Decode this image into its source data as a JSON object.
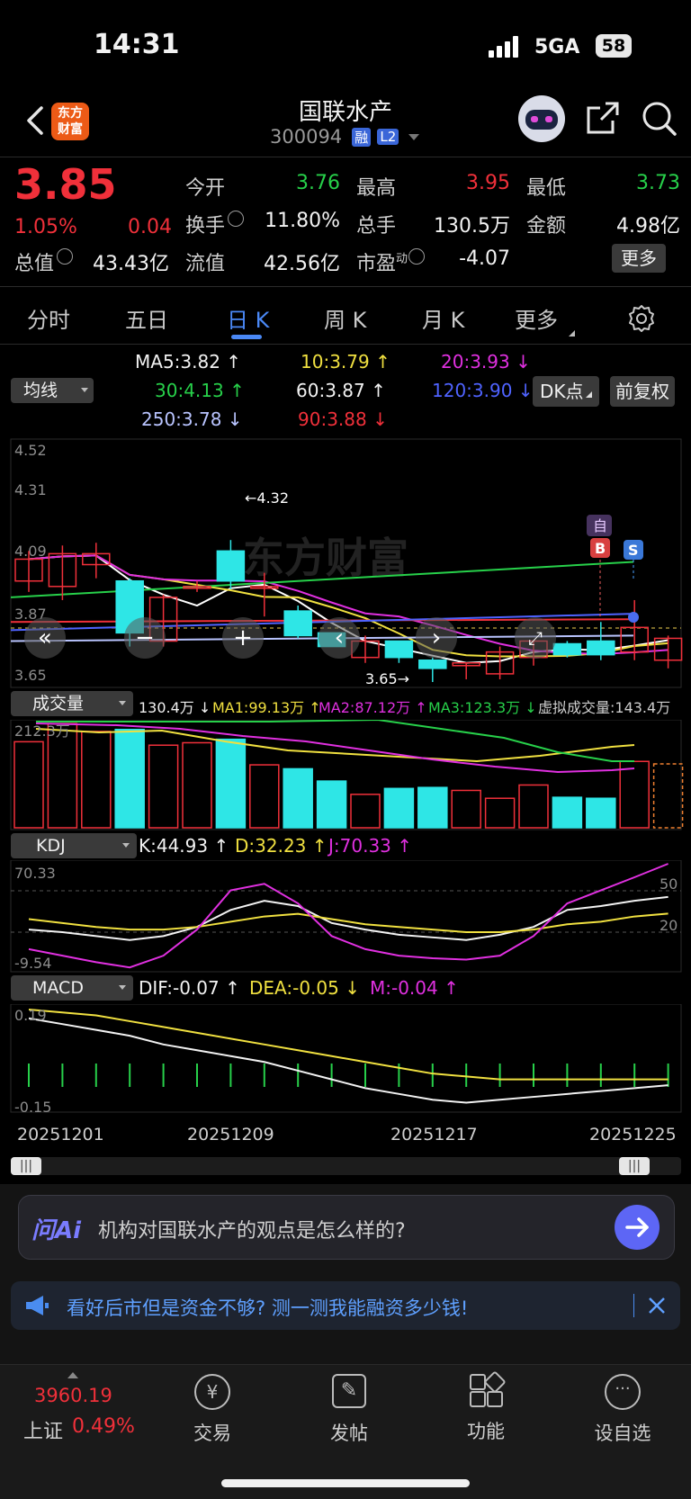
{
  "status_bar": {
    "time": "14:31",
    "network": "5GA",
    "battery": "58"
  },
  "header": {
    "logo_line1": "东方",
    "logo_line2": "财富",
    "stock_name": "国联水产",
    "stock_code": "300094",
    "badge_rong": "融",
    "badge_l2": "L2"
  },
  "quote": {
    "price": "3.85",
    "change_pct": "1.05%",
    "change": "0.04",
    "open_label": "今开",
    "open": "3.76",
    "high_label": "最高",
    "high": "3.95",
    "low_label": "最低",
    "low": "3.73",
    "turnover_label": "换手",
    "turnover": "11.80%",
    "volume_label": "总手",
    "volume": "130.5万",
    "amount_label": "金额",
    "amount": "4.98亿",
    "mktcap_label": "总值",
    "mktcap": "43.43亿",
    "float_label": "流值",
    "float_cap": "42.56亿",
    "pe_label": "市盈",
    "pe_sup": "动",
    "pe": "-4.07",
    "more_label": "更多"
  },
  "tabs": [
    "分时",
    "五日",
    "日 K",
    "周 K",
    "月 K",
    "更多"
  ],
  "ma_legend": {
    "selector": "均线",
    "ma5": "MA5:3.82 ↑",
    "ma10": "10:3.79 ↑",
    "ma20": "20:3.93 ↓",
    "ma30": "30:4.13 ↑",
    "ma60": "60:3.87 ↑",
    "ma120": "120:3.90 ↓",
    "ma250": "250:3.78 ↓",
    "ma90": "90:3.88 ↓",
    "dk_label": "DK点",
    "fq_label": "前复权"
  },
  "price_chart": {
    "y_labels": [
      "4.52",
      "4.31",
      "4.09",
      "3.87",
      "3.65"
    ],
    "high_annot": "←4.32",
    "low_annot": "3.65→",
    "watermark": "东方财富",
    "marker_zi": "自",
    "marker_b": "B",
    "marker_s": "S"
  },
  "volume_legend": {
    "selector": "成交量",
    "vol": "130.4万 ↓",
    "ma1": "MA1:99.13万 ↑",
    "ma2": "MA2:87.12万 ↑",
    "ma3": "MA3:123.3万 ↓",
    "virtual": "虚拟成交量:143.4万",
    "y_max": "212.3万"
  },
  "kdj_legend": {
    "selector": "KDJ",
    "k": "K:44.93 ↑",
    "d": "D:32.23 ↑",
    "j": "J:70.33 ↑",
    "y_top": "70.33",
    "y_bottom": "-9.54",
    "ref50": "50",
    "ref20": "20"
  },
  "macd_legend": {
    "selector": "MACD",
    "dif": "DIF:-0.07 ↑",
    "dea": "DEA:-0.05 ↓",
    "m": "M:-0.04 ↑",
    "y_top": "0.19",
    "y_bottom": "-0.15"
  },
  "dates": [
    "20251201",
    "20251209",
    "20251217",
    "20251225"
  ],
  "ai_bar": {
    "logo": "问Ai",
    "prompt": "机构对国联水产的观点是怎么样的?"
  },
  "ad_banner": {
    "text": "看好后市但是资金不够? 测一测我能融资多少钱!"
  },
  "bottom_nav": {
    "index_value": "3960.19",
    "index_name": "上证",
    "index_pct": "0.49%",
    "items": [
      "交易",
      "发帖",
      "功能",
      "设自选"
    ]
  },
  "colors": {
    "up": "#f0303a",
    "down": "#27d04a",
    "cyan_bar": "#2ee6e6"
  },
  "chart_data": [
    {
      "type": "candlestick",
      "title": "日K",
      "candles": [
        {
          "o": 4.02,
          "h": 4.13,
          "l": 3.98,
          "c": 4.1
        },
        {
          "o": 4.0,
          "h": 4.15,
          "l": 3.95,
          "c": 4.12
        },
        {
          "o": 4.08,
          "h": 4.16,
          "l": 4.03,
          "c": 4.12
        },
        {
          "o": 4.02,
          "h": 4.03,
          "l": 3.78,
          "c": 3.83
        },
        {
          "o": 3.8,
          "h": 3.97,
          "l": 3.78,
          "c": 3.96
        },
        {
          "o": 4.0,
          "h": 4.02,
          "l": 3.98,
          "c": 4.0
        },
        {
          "o": 4.13,
          "h": 4.17,
          "l": 3.99,
          "c": 4.02
        },
        {
          "o": 4.0,
          "h": 4.05,
          "l": 3.89,
          "c": 4.0
        },
        {
          "o": 3.91,
          "h": 3.93,
          "l": 3.81,
          "c": 3.82
        },
        {
          "o": 3.83,
          "h": 3.83,
          "l": 3.78,
          "c": 3.78
        },
        {
          "o": 3.74,
          "h": 3.82,
          "l": 3.72,
          "c": 3.8
        },
        {
          "o": 3.8,
          "h": 3.8,
          "l": 3.72,
          "c": 3.74
        },
        {
          "o": 3.73,
          "h": 3.74,
          "l": 3.65,
          "c": 3.7
        },
        {
          "o": 3.71,
          "h": 3.72,
          "l": 3.66,
          "c": 3.72
        },
        {
          "o": 3.68,
          "h": 3.78,
          "l": 3.66,
          "c": 3.76
        },
        {
          "o": 3.74,
          "h": 3.8,
          "l": 3.71,
          "c": 3.8
        },
        {
          "o": 3.79,
          "h": 3.8,
          "l": 3.74,
          "c": 3.75
        },
        {
          "o": 3.8,
          "h": 3.87,
          "l": 3.73,
          "c": 3.75
        },
        {
          "o": 3.76,
          "h": 3.95,
          "l": 3.73,
          "c": 3.85
        },
        {
          "o": 3.73,
          "h": 3.82,
          "l": 3.7,
          "c": 3.81
        }
      ],
      "ylim": [
        3.65,
        4.52
      ]
    },
    {
      "type": "bar",
      "title": "成交量",
      "values": [
        175,
        212,
        196,
        200,
        168,
        173,
        180,
        128,
        120,
        95,
        68,
        80,
        82,
        76,
        60,
        87,
        62,
        60,
        135,
        130
      ],
      "ylim": [
        0,
        212.3
      ]
    },
    {
      "type": "line",
      "title": "KDJ",
      "series": [
        {
          "name": "K",
          "values": [
            20,
            18,
            15,
            12,
            15,
            22,
            35,
            42,
            38,
            25,
            20,
            16,
            14,
            12,
            16,
            22,
            35,
            38,
            42,
            44.93
          ]
        },
        {
          "name": "D",
          "values": [
            28,
            25,
            22,
            20,
            20,
            22,
            26,
            30,
            32,
            28,
            24,
            22,
            20,
            18,
            18,
            20,
            24,
            26,
            30,
            32.23
          ]
        },
        {
          "name": "J",
          "values": [
            5,
            0,
            -5,
            -9,
            0,
            20,
            50,
            55,
            40,
            15,
            5,
            0,
            -2,
            -3,
            0,
            15,
            40,
            50,
            60,
            70.33
          ]
        }
      ],
      "ylim": [
        -9.54,
        70.33
      ]
    },
    {
      "type": "line",
      "title": "MACD",
      "series": [
        {
          "name": "DIF",
          "values": [
            0.16,
            0.14,
            0.12,
            0.1,
            0.07,
            0.05,
            0.03,
            0.01,
            -0.02,
            -0.05,
            -0.08,
            -0.1,
            -0.12,
            -0.13,
            -0.12,
            -0.11,
            -0.1,
            -0.09,
            -0.08,
            -0.07
          ]
        },
        {
          "name": "DEA",
          "values": [
            0.19,
            0.18,
            0.17,
            0.15,
            0.13,
            0.11,
            0.09,
            0.07,
            0.05,
            0.03,
            0.01,
            -0.01,
            -0.03,
            -0.04,
            -0.05,
            -0.05,
            -0.05,
            -0.05,
            -0.05,
            -0.05
          ]
        }
      ],
      "ylim": [
        -0.15,
        0.19
      ]
    }
  ]
}
